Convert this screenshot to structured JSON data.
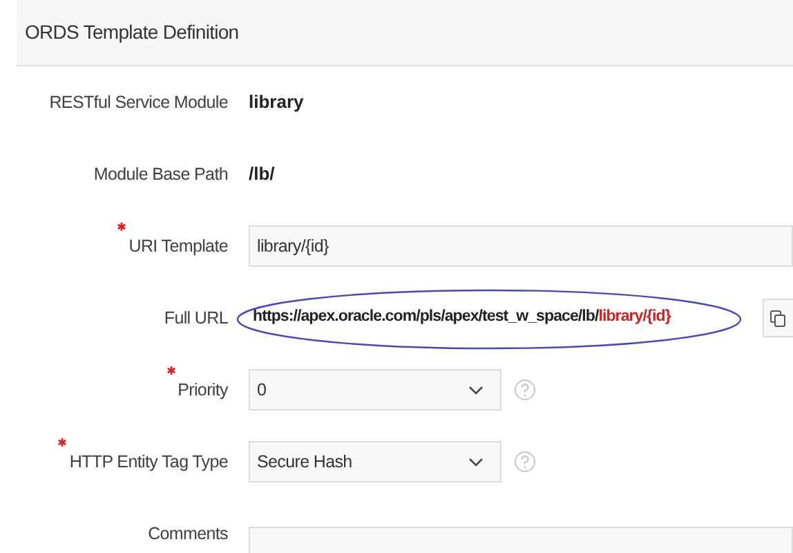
{
  "panel": {
    "title": "ORDS Template Definition"
  },
  "fields": [
    {
      "kind": "display",
      "label": "RESTful Service Module",
      "required": false,
      "value": "library"
    },
    {
      "kind": "display",
      "label": "Module Base Path",
      "required": false,
      "value": "/lb/"
    },
    {
      "kind": "text",
      "label": "URI Template",
      "required": true,
      "value": "library/{id}"
    },
    {
      "kind": "url",
      "label": "Full URL",
      "required": false,
      "value": "https://apex.oracle.com/pls/apex/test_w_space/lb/",
      "value_highlight": "library/{id}",
      "circled": true
    },
    {
      "kind": "select",
      "label": "Priority",
      "required": true,
      "value": "0",
      "help": true
    },
    {
      "kind": "select",
      "label": "HTTP Entity Tag Type",
      "required": true,
      "value": "Secure Hash",
      "help": true
    },
    {
      "kind": "textarea",
      "label": "Comments",
      "required": false
    }
  ]
}
